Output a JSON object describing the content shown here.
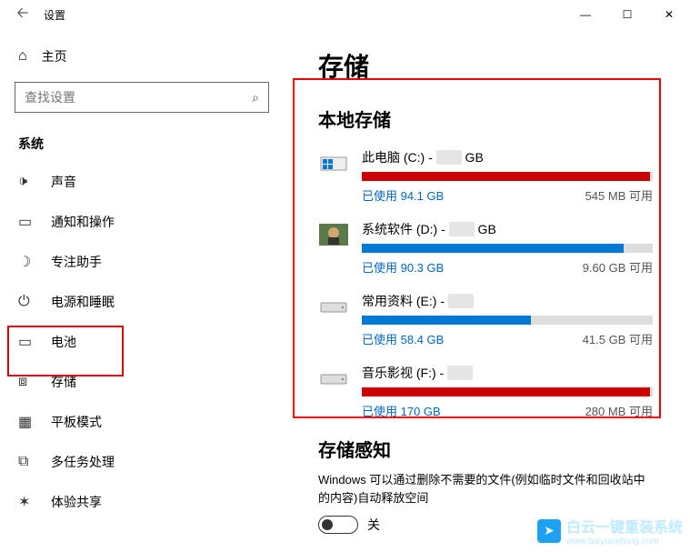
{
  "window": {
    "title": "设置",
    "minimize": "—",
    "maximize": "☐",
    "close": "✕"
  },
  "sidebar": {
    "home": "主页",
    "search_placeholder": "查找设置",
    "section": "系统",
    "items": [
      {
        "icon": "sound",
        "label": "声音"
      },
      {
        "icon": "notify",
        "label": "通知和操作"
      },
      {
        "icon": "focus",
        "label": "专注助手"
      },
      {
        "icon": "power",
        "label": "电源和睡眠"
      },
      {
        "icon": "battery",
        "label": "电池"
      },
      {
        "icon": "storage",
        "label": "存储"
      },
      {
        "icon": "tablet",
        "label": "平板模式"
      },
      {
        "icon": "multitask",
        "label": "多任务处理"
      },
      {
        "icon": "share",
        "label": "体验共享"
      }
    ]
  },
  "main": {
    "title": "存储",
    "local_storage": "本地存储",
    "drives": [
      {
        "name": "此电脑 (C:) - ",
        "size_suffix": " GB",
        "used": "已使用 94.1 GB",
        "free": "545 MB 可用",
        "fill_pct": 99,
        "color": "red",
        "icon": "windows"
      },
      {
        "name": "系统软件 (D:) - ",
        "size_suffix": " GB",
        "used": "已使用 90.3 GB",
        "free": "9.60 GB 可用",
        "fill_pct": 90,
        "color": "blue",
        "icon": "avatar"
      },
      {
        "name": "常用资料 (E:) - ",
        "size_suffix": "",
        "used": "已使用 58.4 GB",
        "free": "41.5 GB 可用",
        "fill_pct": 58,
        "color": "blue",
        "icon": "disk"
      },
      {
        "name": "音乐影视 (F:) - ",
        "size_suffix": "",
        "used": "已使用 170 GB",
        "free": "280 MB 可用",
        "fill_pct": 99,
        "color": "red",
        "icon": "disk"
      }
    ],
    "sense_title": "存储感知",
    "sense_desc": "Windows 可以通过删除不需要的文件(例如临时文件和回收站中的内容)自动释放空间",
    "toggle_label": "关"
  },
  "watermark": {
    "text": "白云一键重装系统",
    "url": "www.baiyunxitong.com"
  }
}
